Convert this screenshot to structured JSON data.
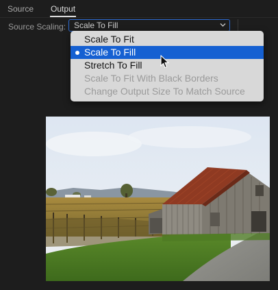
{
  "tabs": [
    {
      "label": "Source",
      "active": false
    },
    {
      "label": "Output",
      "active": true
    }
  ],
  "scaling": {
    "label": "Source Scaling:",
    "selected_value": "Scale To Fill"
  },
  "dropdown": {
    "options": [
      {
        "label": "Scale To Fit",
        "state": "enabled"
      },
      {
        "label": "Scale To Fill",
        "state": "selected"
      },
      {
        "label": "Stretch To Fill",
        "state": "enabled"
      },
      {
        "label": "Scale To Fit With Black Borders",
        "state": "disabled"
      },
      {
        "label": "Change Output Size To Match Source",
        "state": "disabled"
      }
    ]
  },
  "preview": {
    "scene": "barn-vineyard-photo"
  },
  "colors": {
    "accent": "#1560d2",
    "focus_border": "#2e6bd1",
    "panel_bg": "#1d1d1d",
    "menu_bg": "#d8d8d8"
  }
}
